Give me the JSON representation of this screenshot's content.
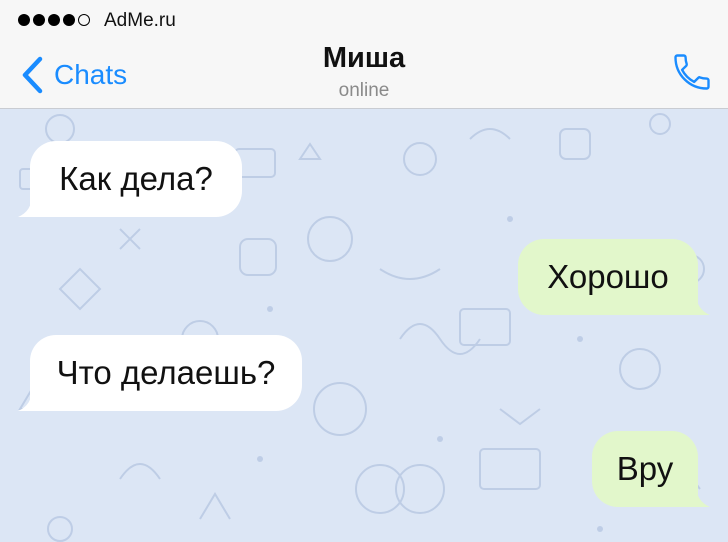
{
  "status_bar": {
    "signal_bars": 5,
    "signal_filled": 4,
    "carrier": "AdMe.ru"
  },
  "nav": {
    "back_label": "Chats",
    "title": "Миша",
    "subtitle": "online",
    "call_icon": "phone-icon",
    "accent_color": "#1a8cff"
  },
  "messages": [
    {
      "direction": "incoming",
      "text": "Как дела?"
    },
    {
      "direction": "outgoing",
      "text": "Хорошо"
    },
    {
      "direction": "incoming",
      "text": "Что делаешь?"
    },
    {
      "direction": "outgoing",
      "text": "Вру"
    }
  ],
  "colors": {
    "chat_background": "#dce6f5",
    "incoming_bubble": "#ffffff",
    "outgoing_bubble": "#e2f7cb"
  }
}
